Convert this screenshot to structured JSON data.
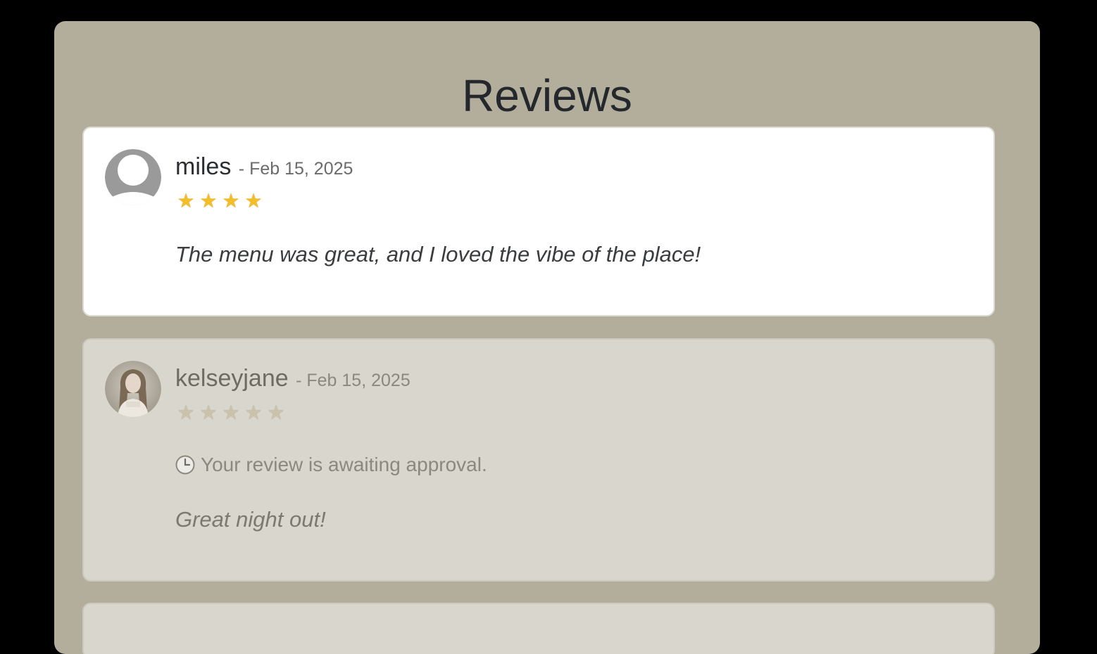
{
  "section": {
    "title": "Reviews"
  },
  "reviews": [
    {
      "username": "miles",
      "date_text": "- Feb 15, 2025",
      "rating": 4,
      "max_rating": 5,
      "comment": "The menu was great, and I loved the vibe of the place!",
      "avatar": "default-user-avatar",
      "status": null
    },
    {
      "username": "kelseyjane",
      "date_text": "- Feb 15, 2025",
      "rating": 0,
      "max_rating": 5,
      "comment": "Great night out!",
      "avatar": "user-photo-avatar",
      "status": "Your review is awaiting approval."
    }
  ],
  "colors": {
    "panel_bg": "#b3ae9c",
    "approved_card_bg": "#ffffff",
    "pending_card_bg": "#d8d6cd",
    "star_filled": "#f1bf2a",
    "star_empty": "#c9c3aa"
  },
  "icons": {
    "status_icon": "clock-icon",
    "star_icon": "star-icon"
  }
}
